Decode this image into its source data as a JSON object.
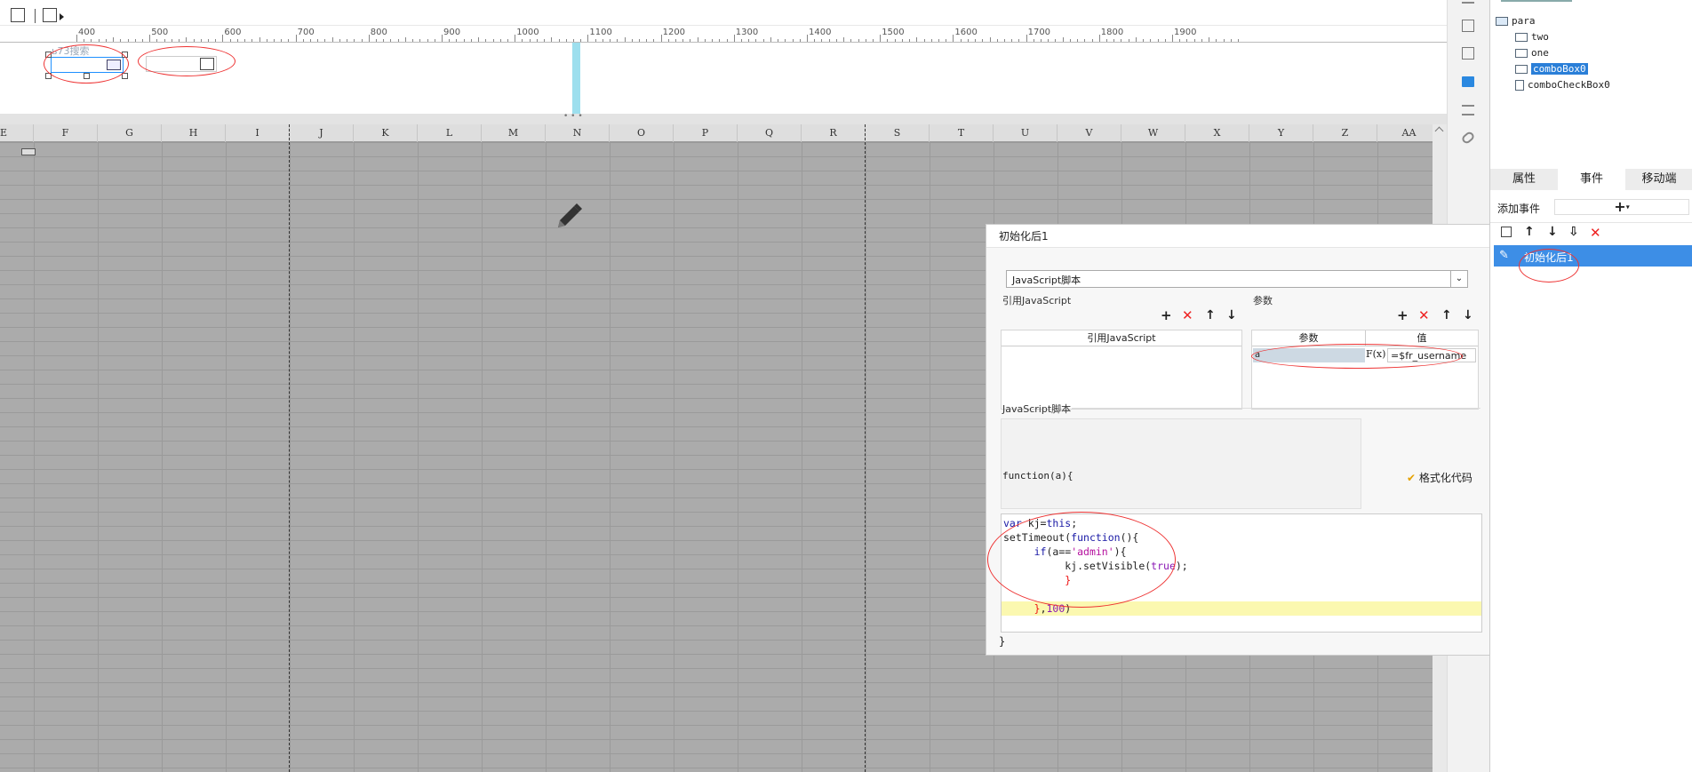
{
  "toolbar": {
    "icons": [
      "widget-tree-icon",
      "form-icon",
      "play-triangle-icon"
    ]
  },
  "ruler": {
    "ticks": [
      "400",
      "500",
      "600",
      "700",
      "800",
      "900",
      "1000",
      "1100",
      "1200",
      "1300",
      "1400",
      "1500",
      "1600",
      "1700",
      "1800",
      "1900"
    ]
  },
  "canvas": {
    "combo_placeholder": "ь73搜索"
  },
  "sheet": {
    "columns": [
      "E",
      "F",
      "G",
      "H",
      "I",
      "J",
      "K",
      "L",
      "M",
      "N",
      "O",
      "P",
      "Q",
      "R",
      "S",
      "T",
      "U",
      "V",
      "W",
      "X",
      "Y",
      "Z",
      "AA"
    ]
  },
  "tree": {
    "root": "para",
    "items": [
      "two",
      "one",
      "comboBox0",
      "comboCheckBox0"
    ],
    "selected": "comboBox0"
  },
  "tabs": [
    "属性",
    "事件",
    "移动端"
  ],
  "active_tab": "事件",
  "events": {
    "add_label": "添加事件",
    "add_button": "+",
    "list": [
      "初始化后1"
    ]
  },
  "dialog": {
    "title": "初始化后1",
    "type_select": "JavaScript脚本",
    "ref_js_label": "引用JavaScript",
    "ref_js_header": "引用JavaScript",
    "params_label": "参数",
    "params_headers": [
      "参数",
      "值"
    ],
    "params_rows": [
      {
        "name": "a",
        "formula_icon": "F(x)",
        "value": "=$fr_username"
      }
    ],
    "script_label": "JavaScript脚本",
    "function_header": "function(a){",
    "format_code": "格式化代码",
    "closing_brace": "}"
  },
  "code_lines": [
    "var kj=this;",
    "setTimeout(function(){",
    "     if(a=='admin'){",
    "          kj.setVisible(true);",
    "          }",
    "",
    "     },100)"
  ],
  "colors": {
    "selection_blue": "#3d8ee6",
    "highlight_yellow": "#fbf8b0",
    "annotation_red": "#e33333",
    "grid_grey": "#ababab"
  }
}
